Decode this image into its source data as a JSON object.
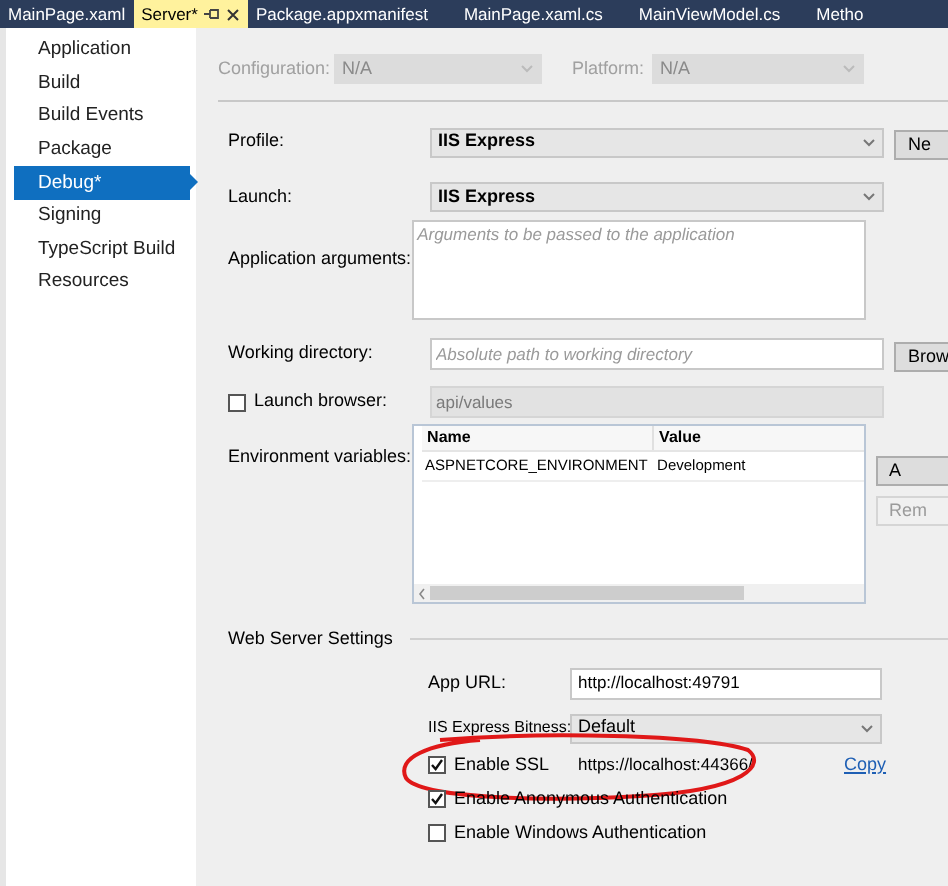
{
  "tabs": [
    {
      "label": "MainPage.xaml",
      "selected": false
    },
    {
      "label": "Server*",
      "selected": true
    },
    {
      "label": "Package.appxmanifest",
      "selected": false
    },
    {
      "label": "MainPage.xaml.cs",
      "selected": false
    },
    {
      "label": "MainViewModel.cs",
      "selected": false
    },
    {
      "label": "Metho",
      "selected": false
    }
  ],
  "sidebar": {
    "items": [
      {
        "label": "Application",
        "selected": false
      },
      {
        "label": "Build",
        "selected": false
      },
      {
        "label": "Build Events",
        "selected": false
      },
      {
        "label": "Package",
        "selected": false
      },
      {
        "label": "Debug*",
        "selected": true
      },
      {
        "label": "Signing",
        "selected": false
      },
      {
        "label": "TypeScript Build",
        "selected": false
      },
      {
        "label": "Resources",
        "selected": false
      }
    ]
  },
  "configuration": {
    "label": "Configuration:",
    "value": "N/A"
  },
  "platform": {
    "label": "Platform:",
    "value": "N/A"
  },
  "profile": {
    "label": "Profile:",
    "value": "IIS Express",
    "button": "Ne"
  },
  "launch": {
    "label": "Launch:",
    "value": "IIS Express"
  },
  "app_arguments": {
    "label": "Application arguments:",
    "placeholder": "Arguments to be passed to the application"
  },
  "working_directory": {
    "label": "Working directory:",
    "placeholder": "Absolute path to working directory",
    "button": "Brow"
  },
  "launch_browser": {
    "label": "Launch browser:",
    "checked": false,
    "value": "api/values"
  },
  "environment_variables": {
    "label": "Environment variables:",
    "columns": [
      "Name",
      "Value"
    ],
    "rows": [
      [
        "ASPNETCORE_ENVIRONMENT",
        "Development"
      ]
    ],
    "buttons": [
      "A",
      "Rem"
    ]
  },
  "web_server_settings": {
    "title": "Web Server Settings",
    "app_url": {
      "label": "App URL:",
      "value": "http://localhost:49791"
    },
    "bitness": {
      "label": "IIS Express Bitness:",
      "value": "Default"
    },
    "options": [
      {
        "label": "Enable SSL",
        "checked": true,
        "url": "https://localhost:44366/",
        "link": "Copy"
      },
      {
        "label": "Enable Anonymous Authentication",
        "checked": true
      },
      {
        "label": "Enable Windows Authentication",
        "checked": false
      }
    ]
  }
}
